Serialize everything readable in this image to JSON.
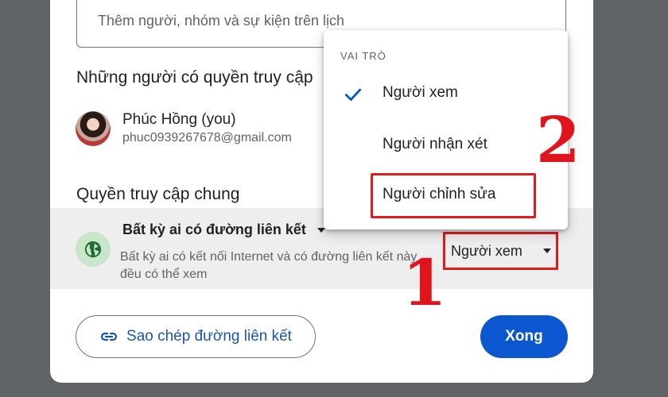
{
  "add_people": {
    "placeholder": "Thêm người, nhóm và sự kiện trên lịch"
  },
  "people_with_access": {
    "title": "Những người có quyền truy cập",
    "user": {
      "name": "Phúc Hồng (you)",
      "email": "phuc0939267678@gmail.com"
    }
  },
  "general_access": {
    "title": "Quyền truy cập chung",
    "link_type": "Bất kỳ ai có đường liên kết",
    "description": "Bất kỳ ai có kết nối Internet và có đường liên kết này đều có thể xem",
    "role": "Người xem"
  },
  "buttons": {
    "copy_link": "Sao chép đường liên kết",
    "done": "Xong"
  },
  "role_menu": {
    "header": "VAI TRÒ",
    "items": [
      {
        "label": "Người xem",
        "selected": true
      },
      {
        "label": "Người nhận xét",
        "selected": false
      },
      {
        "label": "Người chỉnh sửa",
        "selected": false
      }
    ]
  },
  "annotations": {
    "step_1": "1",
    "step_2": "2"
  },
  "colors": {
    "primary": "#0b57d0",
    "link_text": "#1a56b0",
    "annotation_red": "#e31b1b",
    "globe_bg": "#c8e6c9",
    "globe_icon": "#1e6b34",
    "backdrop": "#5f6368"
  },
  "icons": {
    "globe": "globe-icon",
    "link": "link-icon",
    "check": "check-icon",
    "dropdown": "dropdown-arrow-icon"
  }
}
